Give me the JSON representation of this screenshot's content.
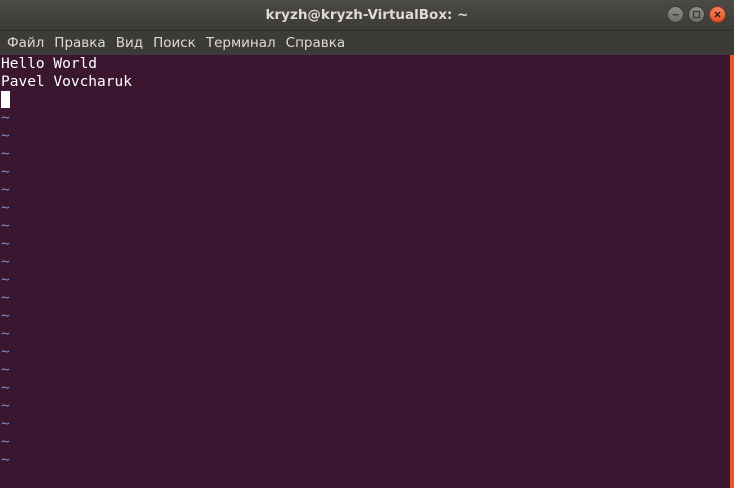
{
  "window": {
    "title": "kryzh@kryzh-VirtualBox: ~"
  },
  "menu": {
    "items": [
      "Файл",
      "Правка",
      "Вид",
      "Поиск",
      "Терминал",
      "Справка"
    ]
  },
  "terminal": {
    "lines": [
      "Hello World",
      "Pavel Vovcharuk"
    ],
    "tilde": "~",
    "tilde_count": 20
  },
  "colors": {
    "terminal_bg": "#3a1631",
    "tilde": "#7f8bcf",
    "scroll_thumb": "#e9582a"
  },
  "icons": {
    "minimize": "minimize-icon",
    "maximize": "maximize-icon",
    "close": "close-icon"
  }
}
